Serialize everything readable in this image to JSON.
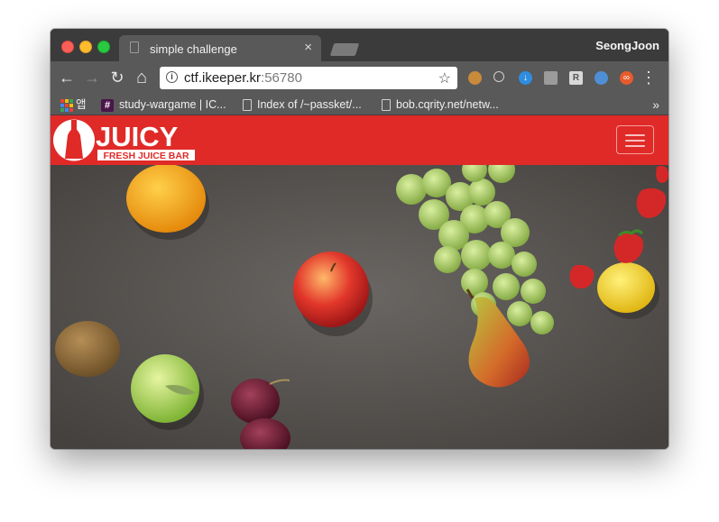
{
  "browser": {
    "tab": {
      "title": "simple challenge",
      "close": "×"
    },
    "profile_name": "SeongJoon",
    "nav": {
      "back": "←",
      "forward": "→",
      "reload": "↻",
      "home": "⌂"
    },
    "address": {
      "host": "ctf.ikeeper.kr",
      "port": ":56780"
    },
    "star": "☆",
    "menu": "⋮",
    "bookmarks": [
      {
        "label": "앱"
      },
      {
        "label": "study-wargame | IC..."
      },
      {
        "label": "Index of /~passket/..."
      },
      {
        "label": "bob.cqrity.net/netw..."
      }
    ],
    "bookmarks_more": "»"
  },
  "page": {
    "brand": "JUICY",
    "tagline": "FRESH JUICE BAR",
    "hero_alt": "fruits on a grey stone surface"
  },
  "colors": {
    "navbar": "#e02a28",
    "surface": "#55524f"
  }
}
